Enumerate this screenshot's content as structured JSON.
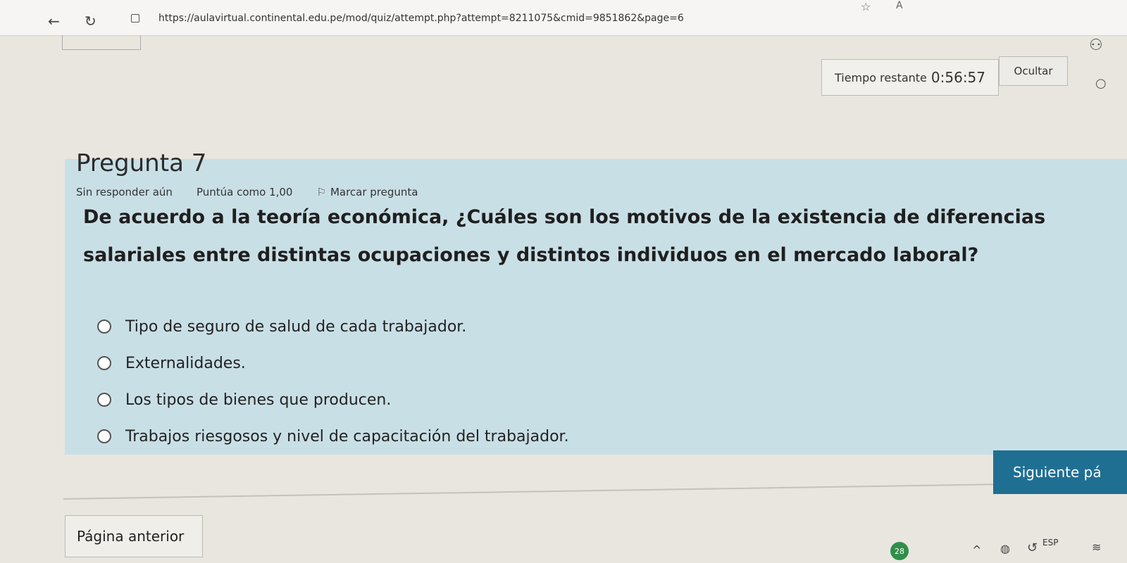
{
  "browser": {
    "url": "https://aulavirtual.continental.edu.pe/mod/quiz/attempt.php?attempt=8211075&cmid=9851862&page=6",
    "back_icon": "arrow-left-icon",
    "reload_icon": "reload-icon"
  },
  "timer": {
    "label": "Tiempo restante",
    "value": "0:56:57",
    "hide_label": "Ocultar"
  },
  "question": {
    "title": "Pregunta 7",
    "status": "Sin responder aún",
    "score": "Puntúa como 1,00",
    "flag_label": "Marcar pregunta",
    "text": "De acuerdo a la teoría económica, ¿Cuáles son los motivos de la existencia de diferencias salariales entre distintas ocupaciones y distintos individuos en el mercado laboral?",
    "options": [
      "Tipo de seguro de salud de cada trabajador.",
      "Externalidades.",
      "Los tipos de bienes que producen.",
      "Trabajos riesgosos y nivel de capacitación del trabajador."
    ]
  },
  "navigation": {
    "next_label": "Siguiente pá",
    "prev_label": "Página anterior"
  },
  "taskbar": {
    "badge": "28",
    "language": "ESP"
  },
  "colors": {
    "panel": "#c9dfe6",
    "next_button": "#1f6f93"
  }
}
